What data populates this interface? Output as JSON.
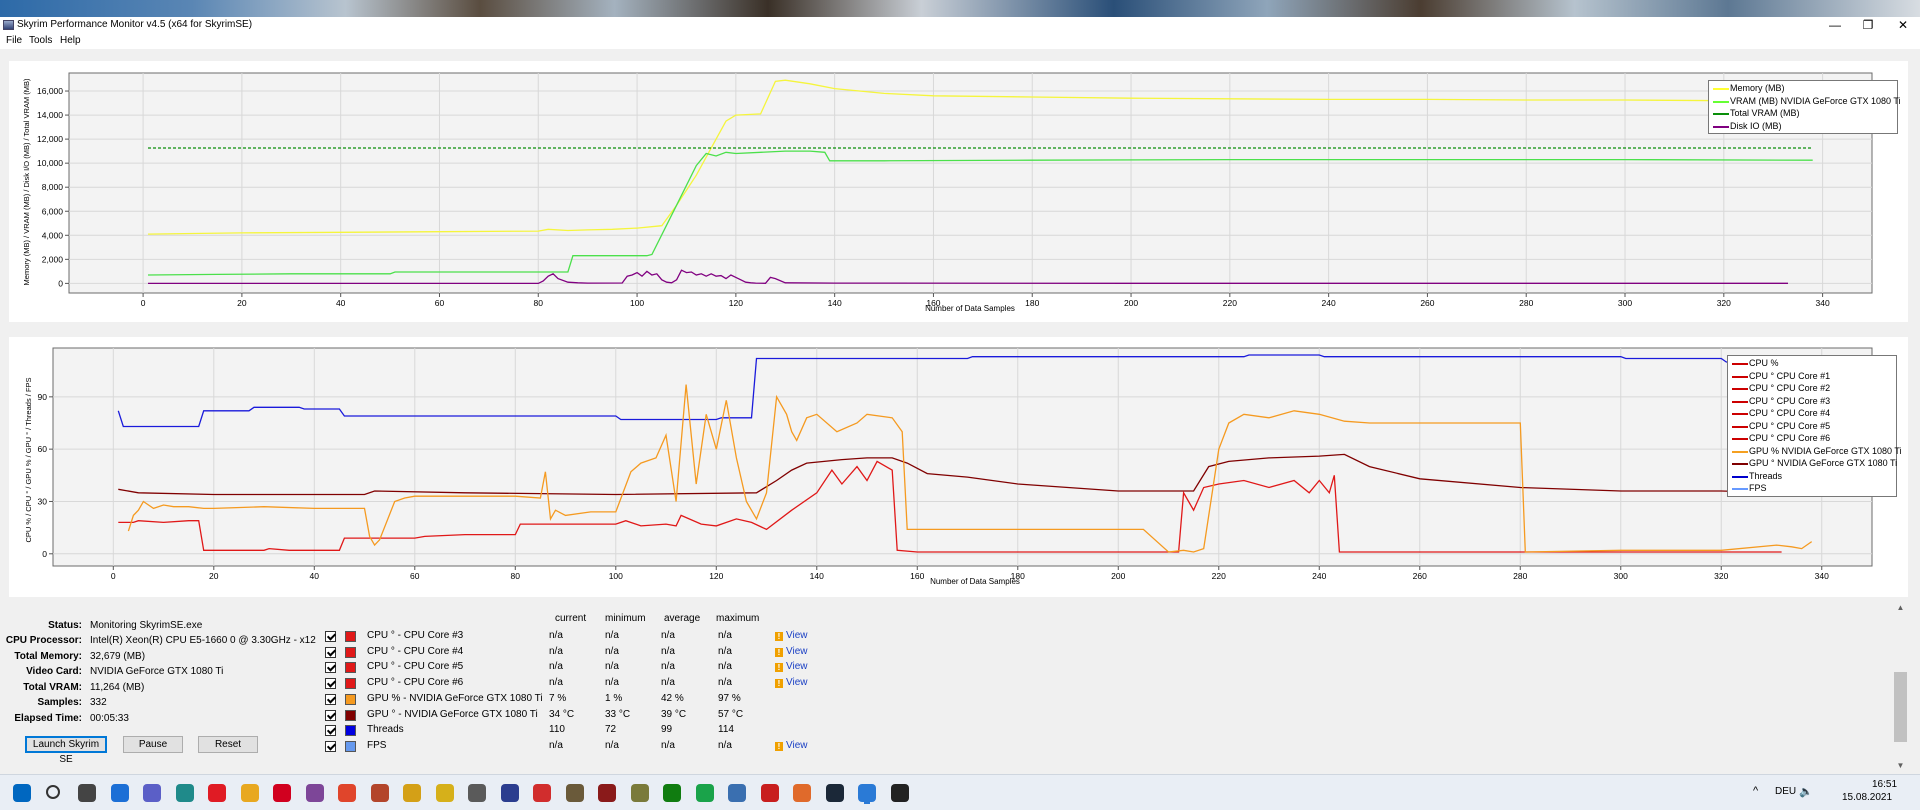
{
  "window": {
    "title": "Skyrim Performance Monitor v4.5 (x64 for SkyrimSE)",
    "controls": {
      "minimize": "—",
      "maximize": "❐",
      "close": "✕"
    }
  },
  "menu": [
    {
      "label": "File"
    },
    {
      "label": "Tools"
    },
    {
      "label": "Help"
    }
  ],
  "chart_data": [
    {
      "type": "line",
      "ylabel": "Memory (MB) / VRAM (MB) / Disk I/O (MB) / Total VRAM (MB)",
      "xlabel": "Number of Data Samples",
      "xlim": [
        -15,
        350
      ],
      "ylim": [
        -800,
        17500
      ],
      "x_ticks": [
        0,
        20,
        40,
        60,
        80,
        100,
        120,
        140,
        160,
        180,
        200,
        220,
        240,
        260,
        280,
        300,
        320,
        340
      ],
      "y_ticks": [
        0,
        2000,
        4000,
        6000,
        8000,
        10000,
        12000,
        14000,
        16000
      ],
      "y_tick_labels": [
        "0",
        "2,000",
        "4,000",
        "6,000",
        "8,000",
        "10,000",
        "12,000",
        "14,000",
        "16,000"
      ],
      "grid": true,
      "legend_position": "top-right",
      "legend": [
        {
          "name": "Memory (MB)",
          "color": "#ffff33"
        },
        {
          "name": "VRAM (MB) NVIDIA GeForce GTX 1080 Ti",
          "color": "#66ff33"
        },
        {
          "name": "Total VRAM (MB)",
          "color": "#0a8f0a"
        },
        {
          "name": "Disk IO (MB)",
          "color": "#800080"
        }
      ],
      "series": [
        {
          "name": "Memory (MB)",
          "color": "#f5f53c",
          "x": [
            1,
            10,
            20,
            40,
            60,
            80,
            82,
            86,
            90,
            95,
            100,
            105,
            108,
            112,
            116,
            118,
            120,
            125,
            128,
            130,
            135,
            140,
            150,
            160,
            180,
            200,
            220,
            240,
            260,
            280,
            300,
            320,
            338
          ],
          "y": [
            4100,
            4150,
            4200,
            4250,
            4300,
            4350,
            4500,
            4400,
            4450,
            4500,
            4600,
            4800,
            6500,
            9000,
            12000,
            13500,
            14000,
            14100,
            16800,
            16900,
            16600,
            16200,
            15800,
            15600,
            15500,
            15400,
            15350,
            15300,
            15300,
            15250,
            15250,
            15200,
            15200
          ]
        },
        {
          "name": "VRAM (MB) NVIDIA GeForce GTX 1080 Ti",
          "color": "#4be04b",
          "x": [
            1,
            15,
            30,
            50,
            51,
            70,
            86,
            87,
            102,
            103,
            108,
            112,
            114,
            116,
            118,
            120,
            125,
            130,
            135,
            138,
            139,
            150,
            180,
            220,
            260,
            300,
            338
          ],
          "y": [
            700,
            750,
            800,
            800,
            950,
            950,
            950,
            2300,
            2300,
            2400,
            6500,
            9800,
            10800,
            10600,
            10900,
            10800,
            10900,
            11000,
            11000,
            10900,
            10200,
            10200,
            10250,
            10300,
            10300,
            10300,
            10250
          ]
        },
        {
          "name": "Total VRAM (MB)",
          "color": "#0a8f0a",
          "dashed": true,
          "x": [
            1,
            338
          ],
          "y": [
            11264,
            11264
          ]
        },
        {
          "name": "Disk IO (MB)",
          "color": "#800080",
          "x": [
            1,
            80,
            81,
            82,
            83,
            84,
            86,
            88,
            90,
            97,
            98,
            99,
            100,
            101,
            102,
            103,
            104,
            105,
            106,
            107,
            108,
            109,
            110,
            111,
            112,
            113,
            114,
            115,
            116,
            117,
            118,
            119,
            120,
            121,
            122,
            123,
            124,
            126,
            127,
            128,
            130,
            140,
            200,
            260,
            333
          ],
          "y": [
            0,
            0,
            200,
            600,
            800,
            400,
            100,
            50,
            20,
            30,
            600,
            700,
            900,
            600,
            1000,
            700,
            800,
            300,
            100,
            50,
            300,
            1100,
            900,
            950,
            700,
            800,
            600,
            800,
            600,
            650,
            400,
            700,
            500,
            300,
            100,
            50,
            20,
            10,
            500,
            400,
            50,
            20,
            10,
            10,
            10
          ]
        }
      ]
    },
    {
      "type": "line",
      "ylabel": "CPU % / CPU ° / GPU % / GPU ° / Threads / FPS",
      "xlabel": "Number of Data Samples",
      "xlim": [
        -12,
        350
      ],
      "ylim": [
        -7,
        118
      ],
      "x_ticks": [
        0,
        20,
        40,
        60,
        80,
        100,
        120,
        140,
        160,
        180,
        200,
        220,
        240,
        260,
        280,
        300,
        320,
        340
      ],
      "y_ticks": [
        0,
        30,
        60,
        90
      ],
      "grid": true,
      "legend_position": "top-right",
      "legend": [
        {
          "name": "CPU %",
          "color": "#cc0000"
        },
        {
          "name": "CPU ° CPU Core #1",
          "color": "#cc0000"
        },
        {
          "name": "CPU ° CPU Core #2",
          "color": "#cc0000"
        },
        {
          "name": "CPU ° CPU Core #3",
          "color": "#cc0000"
        },
        {
          "name": "CPU ° CPU Core #4",
          "color": "#cc0000"
        },
        {
          "name": "CPU ° CPU Core #5",
          "color": "#cc0000"
        },
        {
          "name": "CPU ° CPU Core #6",
          "color": "#cc0000"
        },
        {
          "name": "GPU % NVIDIA GeForce GTX 1080 Ti",
          "color": "#f5a020"
        },
        {
          "name": "GPU ° NVIDIA GeForce GTX 1080 Ti",
          "color": "#800000"
        },
        {
          "name": "Threads",
          "color": "#0000cc"
        },
        {
          "name": "FPS",
          "color": "#6699ff"
        }
      ],
      "series": [
        {
          "name": "Threads",
          "color": "#1a1adb",
          "x": [
            1,
            2,
            10,
            17,
            18,
            27,
            28,
            37,
            38,
            45,
            46,
            100,
            101,
            120,
            121,
            127,
            128,
            170,
            171,
            200,
            201,
            215,
            216,
            225,
            226,
            240,
            241,
            256,
            257,
            300,
            301,
            320,
            321,
            332
          ],
          "y": [
            82,
            73,
            73,
            73,
            82,
            82,
            84,
            84,
            83,
            83,
            79,
            79,
            77,
            77,
            78,
            78,
            112,
            112,
            113,
            113,
            113,
            113,
            113,
            113,
            114,
            114,
            113,
            113,
            113,
            113,
            112,
            112,
            110,
            110
          ]
        },
        {
          "name": "GPU ° NVIDIA GeForce GTX 1080 Ti",
          "color": "#800000",
          "x": [
            1,
            5,
            20,
            40,
            50,
            52,
            70,
            100,
            128,
            132,
            135,
            138,
            145,
            150,
            155,
            158,
            162,
            170,
            180,
            200,
            215,
            218,
            222,
            230,
            240,
            245,
            250,
            260,
            280,
            300,
            320,
            332
          ],
          "y": [
            37,
            35,
            34,
            34,
            34,
            36,
            35,
            34,
            35,
            42,
            48,
            52,
            54,
            55,
            55,
            52,
            46,
            44,
            40,
            36,
            36,
            50,
            53,
            55,
            56,
            57,
            50,
            43,
            38,
            36,
            36,
            35
          ]
        },
        {
          "name": "CPU ° CPU Core #3",
          "color": "#e01818",
          "x": [
            1,
            4,
            5,
            10,
            15,
            17,
            18,
            30,
            31,
            35,
            45,
            46,
            60,
            62,
            70,
            80,
            81,
            100,
            102,
            105,
            110,
            112,
            113,
            117,
            120,
            124,
            127,
            130,
            135,
            140,
            143,
            145,
            148,
            150,
            152,
            155,
            156,
            160,
            180,
            200,
            212,
            213,
            215,
            217,
            220,
            225,
            230,
            235,
            238,
            240,
            242,
            243,
            244,
            260,
            280,
            300,
            320,
            332
          ],
          "y": [
            18,
            18,
            19,
            18,
            19,
            19,
            2,
            2,
            3,
            2,
            2,
            9,
            9,
            10,
            11,
            11,
            17,
            17,
            19,
            16,
            17,
            16,
            22,
            17,
            16,
            20,
            18,
            14,
            25,
            35,
            48,
            40,
            50,
            42,
            53,
            48,
            2,
            1,
            1,
            1,
            1,
            35,
            25,
            38,
            40,
            42,
            38,
            42,
            35,
            42,
            35,
            45,
            1,
            1,
            1,
            1,
            1,
            1
          ]
        },
        {
          "name": "GPU % NVIDIA GeForce GTX 1080 Ti",
          "color": "#f59a20",
          "x": [
            3,
            4,
            5,
            6,
            8,
            10,
            12,
            15,
            18,
            20,
            30,
            40,
            50,
            51,
            52,
            53,
            56,
            58,
            60,
            70,
            80,
            85,
            86,
            87,
            88,
            90,
            95,
            100,
            103,
            105,
            108,
            110,
            112,
            114,
            116,
            118,
            120,
            122,
            124,
            126,
            128,
            130,
            132,
            134,
            135,
            136,
            138,
            140,
            144,
            148,
            150,
            155,
            157,
            158,
            160,
            180,
            200,
            205,
            210,
            213,
            215,
            217,
            220,
            222,
            225,
            230,
            235,
            240,
            245,
            250,
            260,
            270,
            280,
            281,
            300,
            320,
            331,
            334,
            336,
            338
          ],
          "y": [
            13,
            22,
            25,
            30,
            26,
            28,
            27,
            27,
            26,
            26,
            27,
            26,
            26,
            10,
            5,
            8,
            30,
            32,
            33,
            33,
            33,
            32,
            47,
            20,
            25,
            22,
            24,
            24,
            47,
            52,
            55,
            68,
            30,
            97,
            40,
            80,
            60,
            88,
            55,
            30,
            20,
            35,
            90,
            80,
            70,
            65,
            78,
            80,
            70,
            75,
            80,
            78,
            70,
            14,
            14,
            14,
            14,
            14,
            1,
            2,
            1,
            3,
            60,
            75,
            80,
            78,
            82,
            80,
            76,
            75,
            75,
            75,
            75,
            1,
            2,
            2,
            5,
            4,
            3,
            7
          ]
        }
      ]
    }
  ],
  "info": {
    "status_label": "Status:",
    "status_value": "Monitoring SkyrimSE.exe",
    "cpu_label": "CPU Processor:",
    "cpu_value": "Intel(R) Xeon(R) CPU E5-1660 0 @ 3.30GHz - x12",
    "memory_label": "Total Memory:",
    "memory_value": "32,679 (MB)",
    "video_label": "Video Card:",
    "video_value": "NVIDIA GeForce GTX 1080 Ti",
    "vram_label": "Total VRAM:",
    "vram_value": "11,264 (MB)",
    "samples_label": "Samples:",
    "samples_value": "332",
    "elapsed_label": "Elapsed Time:",
    "elapsed_value": "00:05:33"
  },
  "buttons": {
    "launch": "Launch Skyrim SE",
    "pause": "Pause",
    "reset": "Reset"
  },
  "table": {
    "headers": {
      "current": "current",
      "minimum": "minimum",
      "average": "average",
      "maximum": "maximum"
    },
    "rows": [
      {
        "name": "CPU ° - CPU Core #3",
        "color": "#e01818",
        "current": "n/a",
        "minimum": "n/a",
        "average": "n/a",
        "maximum": "n/a",
        "view": "View"
      },
      {
        "name": "CPU ° - CPU Core #4",
        "color": "#e01818",
        "current": "n/a",
        "minimum": "n/a",
        "average": "n/a",
        "maximum": "n/a",
        "view": "View"
      },
      {
        "name": "CPU ° - CPU Core #5",
        "color": "#e01818",
        "current": "n/a",
        "minimum": "n/a",
        "average": "n/a",
        "maximum": "n/a",
        "view": "View"
      },
      {
        "name": "CPU ° - CPU Core #6",
        "color": "#e01818",
        "current": "n/a",
        "minimum": "n/a",
        "average": "n/a",
        "maximum": "n/a",
        "view": "View"
      },
      {
        "name": "GPU % - NVIDIA GeForce GTX 1080 Ti",
        "color": "#f59a20",
        "current": "7 %",
        "minimum": "1 %",
        "average": "42 %",
        "maximum": "97 %",
        "view": ""
      },
      {
        "name": "GPU ° - NVIDIA GeForce GTX 1080 Ti",
        "color": "#800000",
        "current": "34 °C",
        "minimum": "33 °C",
        "average": "39 °C",
        "maximum": "57 °C",
        "view": ""
      },
      {
        "name": "Threads",
        "color": "#0000e0",
        "current": "110",
        "minimum": "72",
        "average": "99",
        "maximum": "114",
        "view": ""
      },
      {
        "name": "FPS",
        "color": "#6699ee",
        "current": "n/a",
        "minimum": "n/a",
        "average": "n/a",
        "maximum": "n/a",
        "view": "View"
      }
    ]
  },
  "scrollbar": {
    "up": "▲",
    "down": "▼"
  },
  "taskbar": {
    "tray_chevron": "^",
    "language": "DEU",
    "time": "16:51",
    "date": "15.08.2021",
    "apps": [
      {
        "name": "start",
        "color": "#0067c0"
      },
      {
        "name": "search",
        "color": "#333333"
      },
      {
        "name": "task-view",
        "color": "#444444"
      },
      {
        "name": "widgets",
        "color": "#1c6fd6"
      },
      {
        "name": "chat",
        "color": "#5b5fc7"
      },
      {
        "name": "app-teal",
        "color": "#1f8a8a"
      },
      {
        "name": "opera",
        "color": "#e01b24"
      },
      {
        "name": "chrome",
        "color": "#e8a820"
      },
      {
        "name": "opera-gx",
        "color": "#d1001f"
      },
      {
        "name": "tor",
        "color": "#7d4698"
      },
      {
        "name": "app-red-square",
        "color": "#e0452b"
      },
      {
        "name": "app-bottle",
        "color": "#b3452b"
      },
      {
        "name": "app-shield",
        "color": "#d4a017"
      },
      {
        "name": "app-clock",
        "color": "#d6b01a"
      },
      {
        "name": "app-document",
        "color": "#5a5a5a"
      },
      {
        "name": "app-blue-bars",
        "color": "#2b3d8f"
      },
      {
        "name": "app-red-circle",
        "color": "#d12d2d"
      },
      {
        "name": "app-robot",
        "color": "#6a5a3a"
      },
      {
        "name": "app-disc",
        "color": "#8a1a1a"
      },
      {
        "name": "app-99",
        "color": "#7a7a3a"
      },
      {
        "name": "xbox",
        "color": "#107c10"
      },
      {
        "name": "app-green-arrow",
        "color": "#1aa34a"
      },
      {
        "name": "app-pen",
        "color": "#3a6fb0"
      },
      {
        "name": "app-red-ring",
        "color": "#c81e1e"
      },
      {
        "name": "mail",
        "color": "#e06a2b"
      },
      {
        "name": "steam-like",
        "color": "#1b2838"
      },
      {
        "name": "monitor",
        "color": "#2a7ad6"
      },
      {
        "name": "skyrim",
        "color": "#222222"
      }
    ]
  }
}
